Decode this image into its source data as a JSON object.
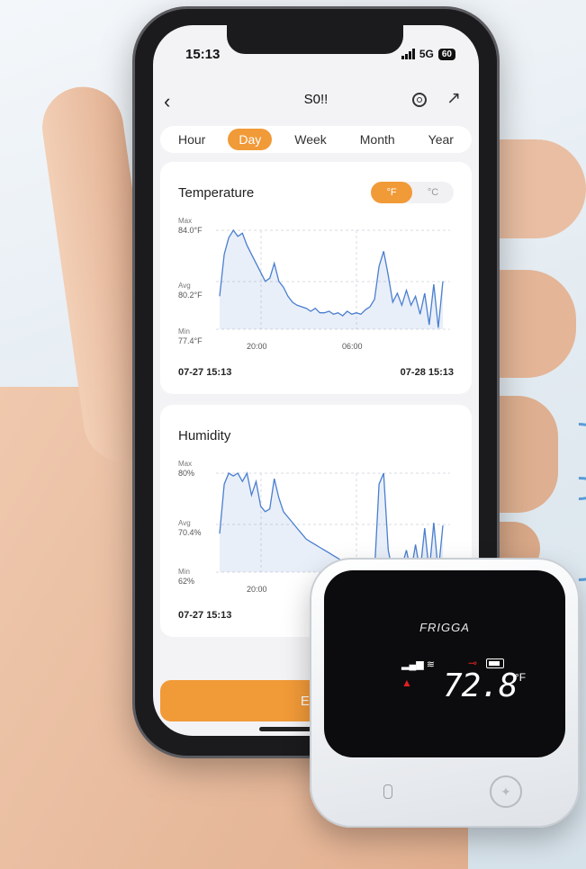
{
  "status": {
    "time": "15:13",
    "network": "5G",
    "battery": "60"
  },
  "nav": {
    "title": "S0!!"
  },
  "tabs": [
    {
      "label": "Hour",
      "active": false
    },
    {
      "label": "Day",
      "active": true
    },
    {
      "label": "Week",
      "active": false
    },
    {
      "label": "Month",
      "active": false
    },
    {
      "label": "Year",
      "active": false
    }
  ],
  "temperature": {
    "title": "Temperature",
    "units": [
      {
        "label": "°F",
        "active": true
      },
      {
        "label": "°C",
        "active": false
      }
    ],
    "max_label": "Max",
    "max_value": "84.0°F",
    "avg_label": "Avg",
    "avg_value": "80.2°F",
    "min_label": "Min",
    "min_value": "77.4°F",
    "xticks": [
      "20:00",
      "06:00"
    ],
    "range_start": "07-27 15:13",
    "range_end": "07-28 15:13"
  },
  "humidity": {
    "title": "Humidity",
    "max_label": "Max",
    "max_value": "80%",
    "avg_label": "Avg",
    "avg_value": "70.4%",
    "min_label": "Min",
    "min_value": "62%",
    "xticks": [
      "20:00"
    ],
    "range_start": "07-27 15:13"
  },
  "export": {
    "label": "Expo"
  },
  "device": {
    "brand": "FRIGGA",
    "reading": "72.8",
    "unit": "°F"
  },
  "colors": {
    "accent": "#f19a38",
    "line": "#4a7fcf",
    "alarm": "#e02020"
  },
  "chart_data": [
    {
      "type": "area",
      "title": "Temperature",
      "ylabel": "",
      "xlabel": "",
      "ylim": [
        77.4,
        84.0
      ],
      "x": [
        0,
        1,
        2,
        3,
        4,
        5,
        6,
        7,
        8,
        9,
        10,
        11,
        12,
        13,
        14,
        15,
        16,
        17,
        18,
        19,
        20,
        21,
        22,
        23,
        24,
        25,
        26,
        27,
        28,
        29,
        30,
        31,
        32,
        33,
        34,
        35,
        36,
        37,
        38,
        39,
        40,
        41,
        42,
        43,
        44,
        45,
        46,
        47,
        48,
        49
      ],
      "series": [
        {
          "values": [
            79.6,
            82.4,
            83.5,
            84.0,
            83.6,
            83.8,
            83.0,
            82.4,
            81.8,
            81.2,
            80.6,
            80.8,
            81.8,
            80.6,
            80.2,
            79.6,
            79.2,
            79.0,
            78.9,
            78.8,
            78.6,
            78.8,
            78.5,
            78.5,
            78.6,
            78.4,
            78.5,
            78.3,
            78.6,
            78.4,
            78.5,
            78.4,
            78.7,
            78.9,
            79.4,
            81.6,
            82.6,
            81.0,
            79.2,
            79.8,
            79.0,
            80.0,
            79.0,
            79.6,
            78.4,
            79.8,
            77.7,
            80.4,
            77.5,
            80.6
          ]
        }
      ]
    },
    {
      "type": "area",
      "title": "Humidity",
      "ylabel": "",
      "xlabel": "",
      "ylim": [
        62,
        80
      ],
      "x": [
        0,
        1,
        2,
        3,
        4,
        5,
        6,
        7,
        8,
        9,
        10,
        11,
        12,
        13,
        14,
        15,
        16,
        17,
        18,
        19,
        20,
        21,
        22,
        23,
        24,
        25,
        26,
        27,
        28,
        29,
        30,
        31,
        32,
        33,
        34,
        35,
        36,
        37,
        38,
        39,
        40,
        41,
        42,
        43,
        44,
        45,
        46,
        47,
        48,
        49
      ],
      "series": [
        {
          "values": [
            69.0,
            78.0,
            80.0,
            79.5,
            80.0,
            78.5,
            80.0,
            76.0,
            78.5,
            74.0,
            73.0,
            73.5,
            79.0,
            75.5,
            73.0,
            72.0,
            71.0,
            70.0,
            69.0,
            68.0,
            67.5,
            67.0,
            66.5,
            66.0,
            65.5,
            65.0,
            64.5,
            64.0,
            63.5,
            63.0,
            62.5,
            62.5,
            62.0,
            62.0,
            62.2,
            78.0,
            80.0,
            66.0,
            62.0,
            64.0,
            63.0,
            66.0,
            62.0,
            67.0,
            62.0,
            70.0,
            62.0,
            71.0,
            62.0,
            70.5
          ]
        }
      ]
    }
  ]
}
